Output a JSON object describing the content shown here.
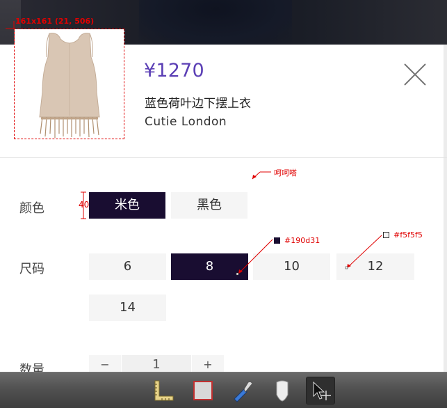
{
  "product": {
    "price": "¥1270",
    "name": "蓝色荷叶边下摆上衣",
    "brand": "Cutie London"
  },
  "color_row": {
    "label": "颜色",
    "options": [
      "米色",
      "黑色"
    ],
    "selected": "米色"
  },
  "size_row": {
    "label": "尺码",
    "options": [
      "6",
      "8",
      "10",
      "12",
      "14"
    ],
    "selected": "8"
  },
  "quantity_row": {
    "label": "数量",
    "minus": "−",
    "value": "1",
    "plus": "+"
  },
  "annotations": {
    "image_size": "161x161 (21, 506)",
    "option_height": "40",
    "note": "呵呵嗒",
    "selected_color": "#190d31",
    "default_color": "#f5f5f5"
  },
  "colors": {
    "accent_price": "#5b3fb5",
    "selected_bg": "#190d31",
    "option_bg": "#f5f5f5",
    "annotation": "#e00000"
  },
  "toolbar": {
    "tools": [
      "ruler-icon",
      "rectangle-icon",
      "eyedropper-icon",
      "pin-icon",
      "move-cursor-icon"
    ],
    "active": "move-cursor-icon"
  }
}
